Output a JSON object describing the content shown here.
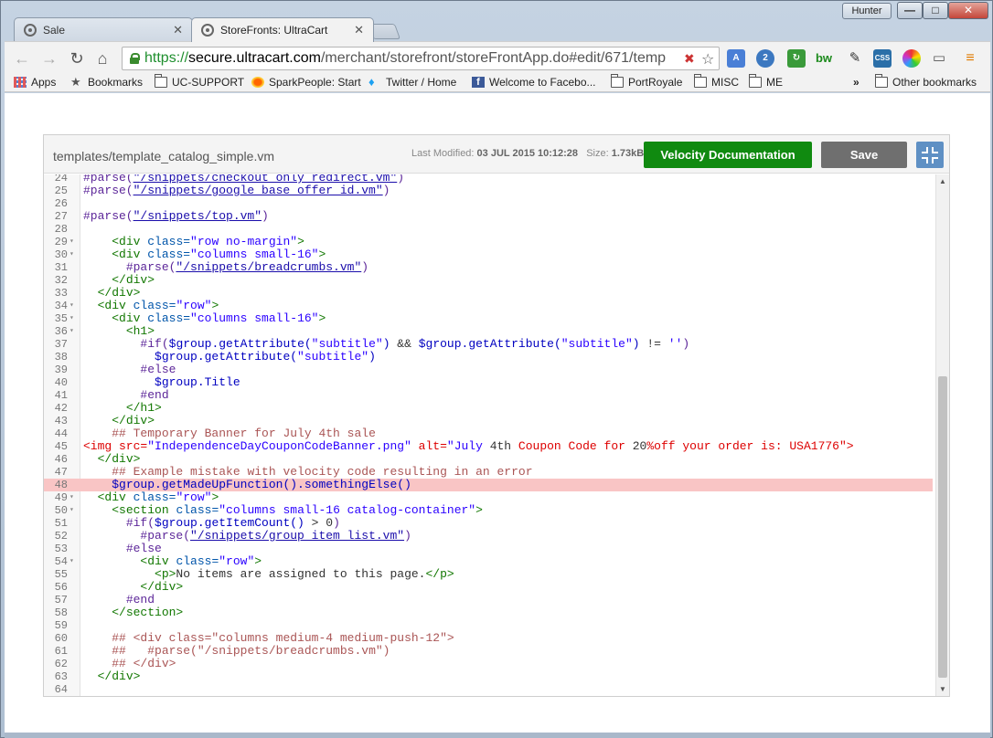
{
  "window": {
    "profile_name": "Hunter",
    "min_glyph": "—",
    "max_glyph": "□",
    "close_glyph": "✕"
  },
  "tabs": [
    {
      "title": "Sale",
      "active": false
    },
    {
      "title": "StoreFronts: UltraCart",
      "active": true
    }
  ],
  "toolbar": {
    "url_proto": "https://",
    "url_host": "secure.ultracart.com",
    "url_path": "/merchant/storefront/storeFrontApp.do#edit/671/temp"
  },
  "bookmarks": [
    {
      "label": "Apps",
      "icon": "apps-icon"
    },
    {
      "label": "Bookmarks",
      "icon": "star-icon"
    },
    {
      "label": "UC-SUPPORT",
      "icon": "folder-icon"
    },
    {
      "label": "SparkPeople: Start",
      "icon": "sparkpeople-icon"
    },
    {
      "label": "Twitter / Home",
      "icon": "twitter-icon"
    },
    {
      "label": "Welcome to Facebo...",
      "icon": "facebook-icon"
    },
    {
      "label": "PortRoyale",
      "icon": "folder-icon"
    },
    {
      "label": "MISC",
      "icon": "folder-icon"
    },
    {
      "label": "ME",
      "icon": "folder-icon"
    },
    {
      "label": "»",
      "icon": ""
    },
    {
      "label": "Other bookmarks",
      "icon": "folder-icon"
    }
  ],
  "editor": {
    "filename": "templates/template_catalog_simple.vm",
    "last_modified_label": "Last Modified:",
    "last_modified_value": "03 JUL 2015 10:12:28",
    "size_label": "Size:",
    "size_value": "1.73kB",
    "doc_button": "Velocity Documentation",
    "save_button": "Save"
  },
  "code": {
    "first_line_number": 24,
    "error_line": 48,
    "scroll_position": 0.97,
    "lines": [
      {
        "n": 24,
        "fold": false,
        "segs": [
          [
            "dir",
            "#parse("
          ],
          [
            "link",
            "\"/snippets/checkout_only_redirect.vm\""
          ],
          [
            "dir",
            ")"
          ]
        ]
      },
      {
        "n": 25,
        "fold": false,
        "segs": [
          [
            "dir",
            "#parse("
          ],
          [
            "link",
            "\"/snippets/google_base_offer_id.vm\""
          ],
          [
            "dir",
            ")"
          ]
        ]
      },
      {
        "n": 26,
        "fold": false,
        "segs": []
      },
      {
        "n": 27,
        "fold": false,
        "segs": [
          [
            "dir",
            "#parse("
          ],
          [
            "link",
            "\"/snippets/top.vm\""
          ],
          [
            "dir",
            ")"
          ]
        ]
      },
      {
        "n": 28,
        "fold": false,
        "segs": []
      },
      {
        "n": 29,
        "fold": true,
        "segs": [
          [
            "plain",
            "    "
          ],
          [
            "tag",
            "<div "
          ],
          [
            "attr",
            "class="
          ],
          [
            "str",
            "\"row no-margin\""
          ],
          [
            "tag",
            ">"
          ]
        ]
      },
      {
        "n": 30,
        "fold": true,
        "segs": [
          [
            "plain",
            "    "
          ],
          [
            "tag",
            "<div "
          ],
          [
            "attr",
            "class="
          ],
          [
            "str",
            "\"columns small-16\""
          ],
          [
            "tag",
            ">"
          ]
        ]
      },
      {
        "n": 31,
        "fold": false,
        "segs": [
          [
            "plain",
            "      "
          ],
          [
            "dir",
            "#parse("
          ],
          [
            "link",
            "\"/snippets/breadcrumbs.vm\""
          ],
          [
            "dir",
            ")"
          ]
        ]
      },
      {
        "n": 32,
        "fold": false,
        "segs": [
          [
            "plain",
            "    "
          ],
          [
            "tag",
            "</div>"
          ]
        ]
      },
      {
        "n": 33,
        "fold": false,
        "segs": [
          [
            "plain",
            "  "
          ],
          [
            "tag",
            "</div>"
          ]
        ]
      },
      {
        "n": 34,
        "fold": true,
        "segs": [
          [
            "plain",
            "  "
          ],
          [
            "tag",
            "<div "
          ],
          [
            "attr",
            "class="
          ],
          [
            "str",
            "\"row\""
          ],
          [
            "tag",
            ">"
          ]
        ]
      },
      {
        "n": 35,
        "fold": true,
        "segs": [
          [
            "plain",
            "    "
          ],
          [
            "tag",
            "<div "
          ],
          [
            "attr",
            "class="
          ],
          [
            "str",
            "\"columns small-16\""
          ],
          [
            "tag",
            ">"
          ]
        ]
      },
      {
        "n": 36,
        "fold": true,
        "segs": [
          [
            "plain",
            "      "
          ],
          [
            "tag",
            "<h1>"
          ]
        ]
      },
      {
        "n": 37,
        "fold": false,
        "segs": [
          [
            "plain",
            "        "
          ],
          [
            "dir",
            "#if("
          ],
          [
            "var",
            "$group.getAttribute("
          ],
          [
            "str",
            "\"subtitle\""
          ],
          [
            "var",
            ")"
          ],
          [
            "plain",
            " && "
          ],
          [
            "var",
            "$group.getAttribute("
          ],
          [
            "str",
            "\"subtitle\""
          ],
          [
            "var",
            ")"
          ],
          [
            "plain",
            " != "
          ],
          [
            "str",
            "''"
          ],
          [
            "dir",
            ")"
          ]
        ]
      },
      {
        "n": 38,
        "fold": false,
        "segs": [
          [
            "plain",
            "          "
          ],
          [
            "var",
            "$group.getAttribute("
          ],
          [
            "str",
            "\"subtitle\""
          ],
          [
            "var",
            ")"
          ]
        ]
      },
      {
        "n": 39,
        "fold": false,
        "segs": [
          [
            "plain",
            "        "
          ],
          [
            "dir",
            "#else"
          ]
        ]
      },
      {
        "n": 40,
        "fold": false,
        "segs": [
          [
            "plain",
            "          "
          ],
          [
            "var",
            "$group.Title"
          ]
        ]
      },
      {
        "n": 41,
        "fold": false,
        "segs": [
          [
            "plain",
            "        "
          ],
          [
            "dir",
            "#end"
          ]
        ]
      },
      {
        "n": 42,
        "fold": false,
        "segs": [
          [
            "plain",
            "      "
          ],
          [
            "tag",
            "</h1>"
          ]
        ]
      },
      {
        "n": 43,
        "fold": false,
        "segs": [
          [
            "plain",
            "    "
          ],
          [
            "tag",
            "</div>"
          ]
        ]
      },
      {
        "n": 44,
        "fold": false,
        "segs": [
          [
            "plain",
            "    "
          ],
          [
            "com",
            "## Temporary Banner for July 4th sale"
          ]
        ]
      },
      {
        "n": 45,
        "fold": false,
        "segs": [
          [
            "red",
            "<img src="
          ],
          [
            "str",
            "\"IndependenceDayCouponCodeBanner.png\""
          ],
          [
            "red",
            " alt="
          ],
          [
            "str",
            "\"July "
          ],
          [
            "plain",
            "4th"
          ],
          [
            "red",
            " Coupon Code for "
          ],
          [
            "plain",
            "20"
          ],
          [
            "red",
            "%off your order is: USA1776\">"
          ]
        ]
      },
      {
        "n": 46,
        "fold": false,
        "segs": [
          [
            "plain",
            "  "
          ],
          [
            "tag",
            "</div>"
          ]
        ]
      },
      {
        "n": 47,
        "fold": false,
        "segs": [
          [
            "plain",
            "    "
          ],
          [
            "com",
            "## Example mistake with velocity code resulting in an error"
          ]
        ]
      },
      {
        "n": 48,
        "fold": false,
        "segs": [
          [
            "plain",
            "    "
          ],
          [
            "var",
            "$group.getMadeUpFunction().somethingElse()"
          ]
        ]
      },
      {
        "n": 49,
        "fold": true,
        "segs": [
          [
            "plain",
            "  "
          ],
          [
            "tag",
            "<div "
          ],
          [
            "attr",
            "class="
          ],
          [
            "str",
            "\"row\""
          ],
          [
            "tag",
            ">"
          ]
        ]
      },
      {
        "n": 50,
        "fold": true,
        "segs": [
          [
            "plain",
            "    "
          ],
          [
            "tag",
            "<section "
          ],
          [
            "attr",
            "class="
          ],
          [
            "str",
            "\"columns small-16 catalog-container\""
          ],
          [
            "tag",
            ">"
          ]
        ]
      },
      {
        "n": 51,
        "fold": false,
        "segs": [
          [
            "plain",
            "      "
          ],
          [
            "dir",
            "#if("
          ],
          [
            "var",
            "$group.getItemCount()"
          ],
          [
            "plain",
            " > 0"
          ],
          [
            "dir",
            ")"
          ]
        ]
      },
      {
        "n": 52,
        "fold": false,
        "segs": [
          [
            "plain",
            "        "
          ],
          [
            "dir",
            "#parse("
          ],
          [
            "link",
            "\"/snippets/group_item_list.vm\""
          ],
          [
            "dir",
            ")"
          ]
        ]
      },
      {
        "n": 53,
        "fold": false,
        "segs": [
          [
            "plain",
            "      "
          ],
          [
            "dir",
            "#else"
          ]
        ]
      },
      {
        "n": 54,
        "fold": true,
        "segs": [
          [
            "plain",
            "        "
          ],
          [
            "tag",
            "<div "
          ],
          [
            "attr",
            "class="
          ],
          [
            "str",
            "\"row\""
          ],
          [
            "tag",
            ">"
          ]
        ]
      },
      {
        "n": 55,
        "fold": false,
        "segs": [
          [
            "plain",
            "          "
          ],
          [
            "tag",
            "<p>"
          ],
          [
            "plain",
            "No items are assigned to this page."
          ],
          [
            "tag",
            "</p>"
          ]
        ]
      },
      {
        "n": 56,
        "fold": false,
        "segs": [
          [
            "plain",
            "        "
          ],
          [
            "tag",
            "</div>"
          ]
        ]
      },
      {
        "n": 57,
        "fold": false,
        "segs": [
          [
            "plain",
            "      "
          ],
          [
            "dir",
            "#end"
          ]
        ]
      },
      {
        "n": 58,
        "fold": false,
        "segs": [
          [
            "plain",
            "    "
          ],
          [
            "tag",
            "</section>"
          ]
        ]
      },
      {
        "n": 59,
        "fold": false,
        "segs": []
      },
      {
        "n": 60,
        "fold": false,
        "segs": [
          [
            "plain",
            "    "
          ],
          [
            "com",
            "## <div class=\"columns medium-4 medium-push-12\">"
          ]
        ]
      },
      {
        "n": 61,
        "fold": false,
        "segs": [
          [
            "plain",
            "    "
          ],
          [
            "com",
            "##   #parse(\"/snippets/breadcrumbs.vm\")"
          ]
        ]
      },
      {
        "n": 62,
        "fold": false,
        "segs": [
          [
            "plain",
            "    "
          ],
          [
            "com",
            "## </div>"
          ]
        ]
      },
      {
        "n": 63,
        "fold": false,
        "segs": [
          [
            "plain",
            "  "
          ],
          [
            "tag",
            "</div>"
          ]
        ]
      },
      {
        "n": 64,
        "fold": false,
        "segs": []
      }
    ]
  },
  "colors": {
    "doc_button": "#108a10",
    "save_button": "#6f6f6f",
    "fullscreen_button": "#5f90c4",
    "error_line": "#f9c5c5"
  }
}
